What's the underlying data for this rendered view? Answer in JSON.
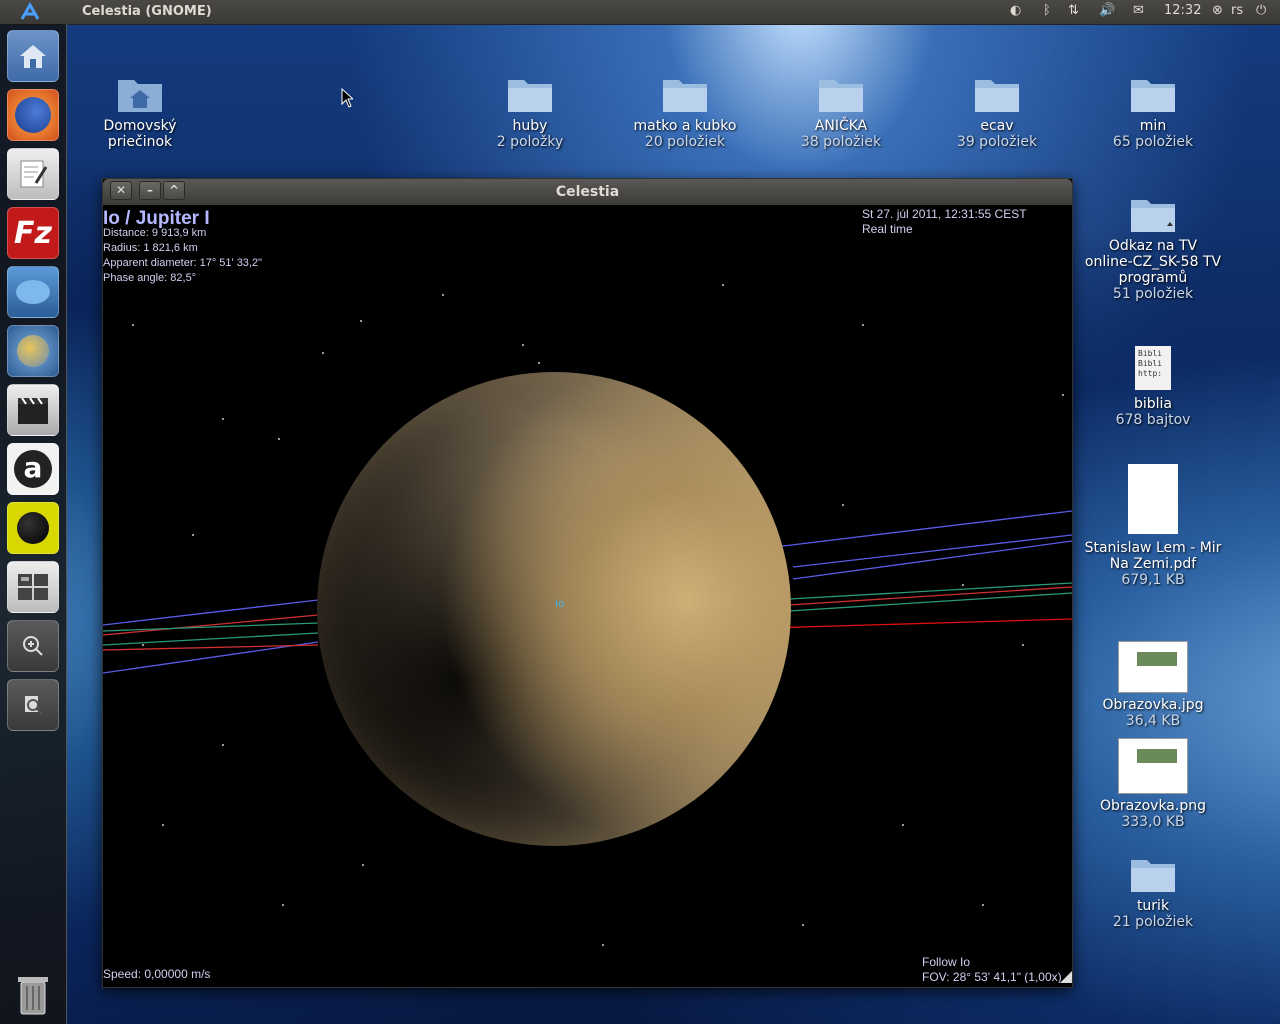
{
  "top_panel": {
    "app_title": "Celestia (GNOME)",
    "time": "12:32",
    "user": "rs"
  },
  "desktop_icons": [
    {
      "label": "Domovský\npriečinok",
      "sub": ""
    },
    {
      "label": "huby",
      "sub": "2 položky"
    },
    {
      "label": "matko a kubko",
      "sub": "20 položiek"
    },
    {
      "label": "ANIČKA",
      "sub": "38 položiek"
    },
    {
      "label": "ecav",
      "sub": "39 položiek"
    },
    {
      "label": "min",
      "sub": "65 položiek"
    },
    {
      "label": "Odkaz na TV online-CZ_SK-58 TV programů",
      "sub": "51 položiek"
    },
    {
      "label": "biblia",
      "sub": "678 bajtov"
    },
    {
      "label": "Stanislaw Lem - Mir Na Zemi.pdf",
      "sub": "679,1 KB"
    },
    {
      "label": "Obrazovka.jpg",
      "sub": "36,4 KB"
    },
    {
      "label": "Obrazovka.png",
      "sub": "333,0 KB"
    },
    {
      "label": "turik",
      "sub": "21 položiek"
    }
  ],
  "window": {
    "title": "Celestia",
    "close": "✕",
    "minimize": "–",
    "maximize": "^"
  },
  "hud": {
    "object": "Io / Jupiter I",
    "distance": "Distance: 9 913,9 km",
    "radius": "Radius: 1 821,6 km",
    "apparent": "Apparent diameter: 17° 51' 33,2\"",
    "phase": "Phase angle: 82,5°",
    "datetime": "St 27. júl 2011, 12:31:55 CEST",
    "timemode": "Real time",
    "label": "Io",
    "speed": "Speed: 0,00000 m/s",
    "follow": "Follow Io",
    "fov": "FOV: 28° 53' 41,1\" (1,00x)"
  },
  "file_icon_text": {
    "bibli1": "Bibli",
    "bibli2": "Bibli",
    "http": "http:"
  }
}
